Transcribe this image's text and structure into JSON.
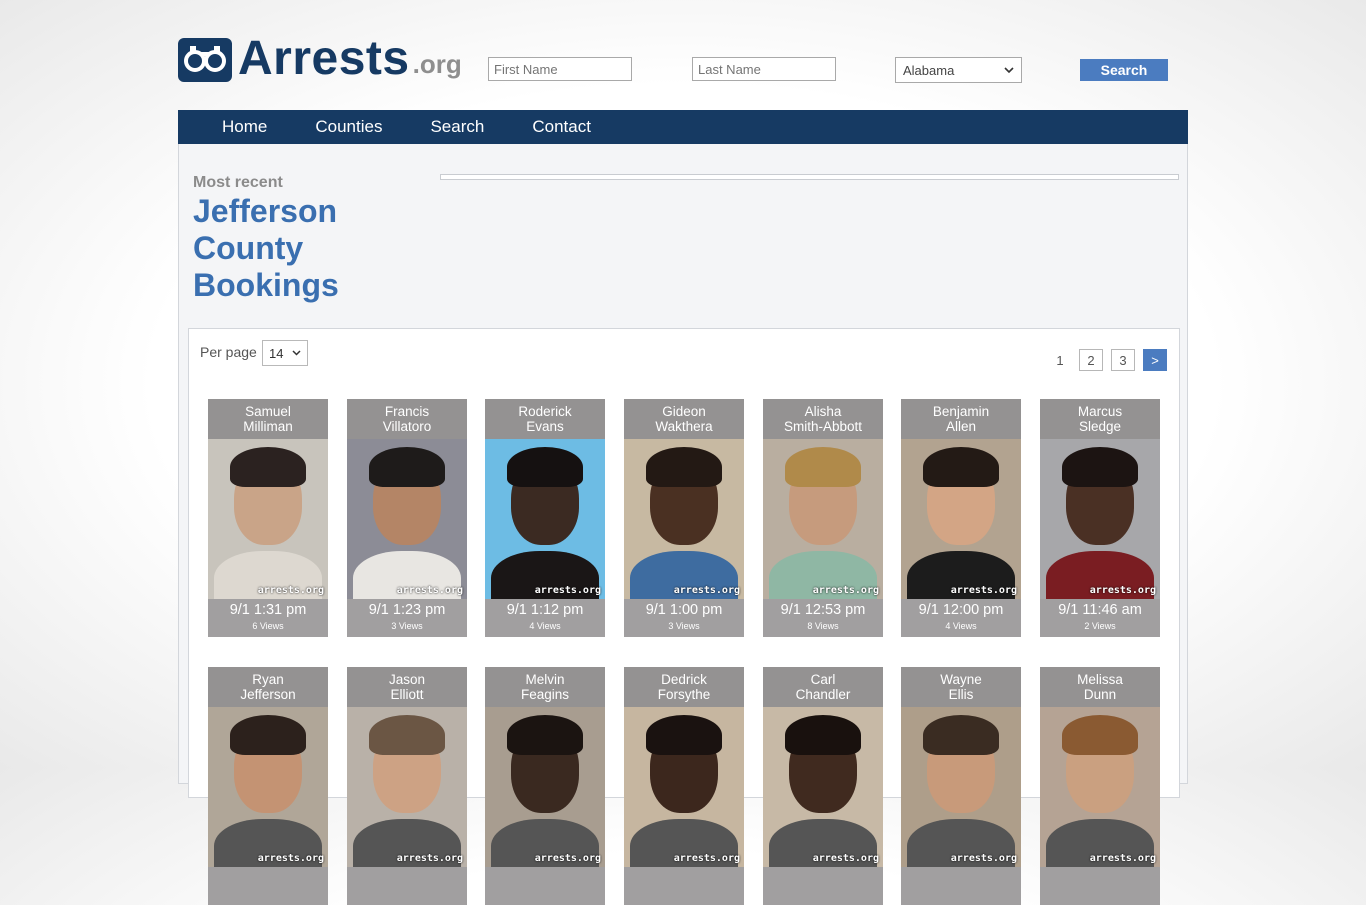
{
  "header": {
    "logo_text": "Arrests",
    "logo_tld": ".org",
    "first_name_placeholder": "First Name",
    "last_name_placeholder": "Last Name",
    "state_selected": "Alabama",
    "search_label": "Search"
  },
  "nav": [
    "Home",
    "Counties",
    "Search",
    "Contact"
  ],
  "page": {
    "most_recent": "Most recent",
    "title": "Jefferson County Bookings",
    "per_page_label": "Per page",
    "per_page_value": "14",
    "pages": [
      "1",
      "2",
      "3",
      ">"
    ]
  },
  "watermark": "arrests.org",
  "cards": [
    {
      "first": "Samuel",
      "last": "Milliman",
      "time": "9/1 1:31 pm",
      "views": "6 Views",
      "bg": "#c8c4bc",
      "skin": "#c9a488",
      "hair": "#2b2220",
      "body": "#ddd8d0"
    },
    {
      "first": "Francis",
      "last": "Villatoro",
      "time": "9/1 1:23 pm",
      "views": "3 Views",
      "bg": "#8c8c96",
      "skin": "#b48566",
      "hair": "#1e1b1a",
      "body": "#e8e6e2"
    },
    {
      "first": "Roderick",
      "last": "Evans",
      "time": "9/1 1:12 pm",
      "views": "4 Views",
      "bg": "#6dbce4",
      "skin": "#3b2a22",
      "hair": "#151111",
      "body": "#1a1616"
    },
    {
      "first": "Gideon",
      "last": "Wakthera",
      "time": "9/1 1:00 pm",
      "views": "3 Views",
      "bg": "#c7b9a2",
      "skin": "#4a3022",
      "hair": "#231914",
      "body": "#3e6ca0"
    },
    {
      "first": "Alisha",
      "last": "Smith-Abbott",
      "time": "9/1 12:53 pm",
      "views": "8 Views",
      "bg": "#b9aea0",
      "skin": "#c69b7d",
      "hair": "#b08a4a",
      "body": "#8fb7a4"
    },
    {
      "first": "Benjamin",
      "last": "Allen",
      "time": "9/1 12:00 pm",
      "views": "4 Views",
      "bg": "#b2a390",
      "skin": "#d3a585",
      "hair": "#231a15",
      "body": "#1c1c1c"
    },
    {
      "first": "Marcus",
      "last": "Sledge",
      "time": "9/1 11:46 am",
      "views": "2 Views",
      "bg": "#a7a7aa",
      "skin": "#4a3024",
      "hair": "#1c1412",
      "body": "#7a1d22"
    },
    {
      "first": "Ryan",
      "last": "Jefferson",
      "time": "",
      "views": "",
      "bg": "#b0a698",
      "skin": "#c49373",
      "hair": "#2c211c",
      "body": "#555"
    },
    {
      "first": "Jason",
      "last": "Elliott",
      "time": "",
      "views": "",
      "bg": "#b9b1a8",
      "skin": "#cda284",
      "hair": "#6b5644",
      "body": "#555"
    },
    {
      "first": "Melvin",
      "last": "Feagins",
      "time": "",
      "views": "",
      "bg": "#a89d90",
      "skin": "#3a2920",
      "hair": "#1b1411",
      "body": "#555"
    },
    {
      "first": "Dedrick",
      "last": "Forsythe",
      "time": "",
      "views": "",
      "bg": "#c6b6a0",
      "skin": "#3c271d",
      "hair": "#1a1210",
      "body": "#555"
    },
    {
      "first": "Carl",
      "last": "Chandler",
      "time": "",
      "views": "",
      "bg": "#c7b9a6",
      "skin": "#402a1f",
      "hair": "#19110e",
      "body": "#555"
    },
    {
      "first": "Wayne",
      "last": "Ellis",
      "time": "",
      "views": "",
      "bg": "#ae9e8a",
      "skin": "#c89a7a",
      "hair": "#3a2c22",
      "body": "#555"
    },
    {
      "first": "Melissa",
      "last": "Dunn",
      "time": "",
      "views": "",
      "bg": "#b5a394",
      "skin": "#caa080",
      "hair": "#8a5a32",
      "body": "#555"
    }
  ]
}
